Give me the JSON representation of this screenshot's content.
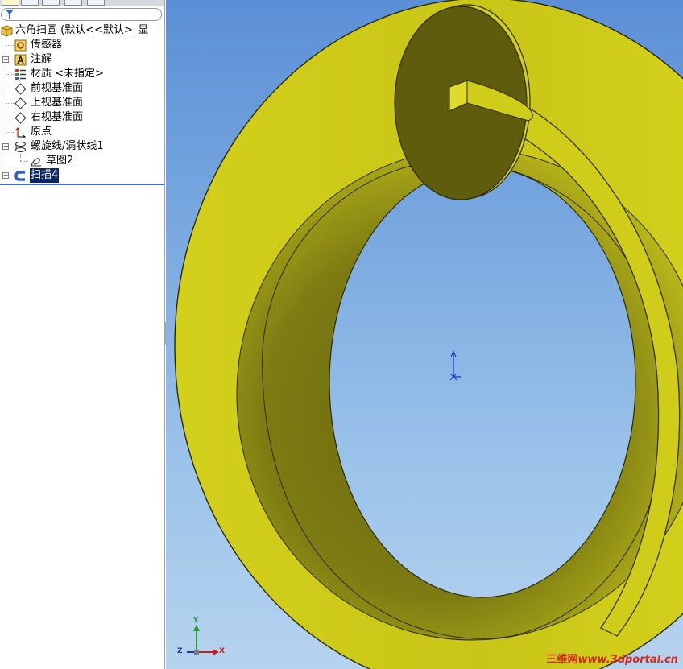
{
  "feature_tree": {
    "root_label": "六角扫圆  (默认<<默认>_显",
    "items": [
      {
        "label": "传感器",
        "icon": "sensors-icon"
      },
      {
        "label": "注解",
        "icon": "annotations-icon"
      },
      {
        "label": "材质 <未指定>",
        "icon": "material-icon"
      },
      {
        "label": "前视基准面",
        "icon": "front-plane-icon"
      },
      {
        "label": "上视基准面",
        "icon": "top-plane-icon"
      },
      {
        "label": "右视基准面",
        "icon": "right-plane-icon"
      },
      {
        "label": "原点",
        "icon": "origin-icon"
      },
      {
        "label": "螺旋线/涡状线1",
        "icon": "helix-icon"
      },
      {
        "label": "草图2",
        "icon": "sketch-icon"
      },
      {
        "label": "扫描4",
        "icon": "sweep-icon"
      }
    ]
  },
  "triad": {
    "y_label": "Y",
    "x_label": "X",
    "z_label": "Z"
  },
  "watermark": {
    "brand": "三维网",
    "site": "www.3dportal.cn"
  },
  "colors": {
    "part_face": "#c9c716",
    "part_shadow": "#5e5c0c",
    "part_dark": "#4a4a0a",
    "selection": "#0a246a",
    "watermark": "#d8261b"
  }
}
